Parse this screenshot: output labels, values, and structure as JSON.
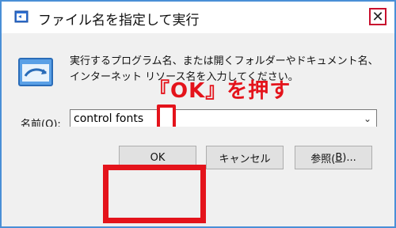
{
  "window": {
    "title": "ファイル名を指定して実行",
    "close_glyph": "✕"
  },
  "description": "実行するプログラム名、または開くフォルダーやドキュメント名、インターネット リソース名を入力してください。",
  "annotation": {
    "text": "『OK』を押す",
    "color": "#e4131b"
  },
  "name_field": {
    "label_prefix": "名前(",
    "label_key": "O",
    "label_suffix": "):",
    "value": "control fonts",
    "dropdown_glyph": "⌄"
  },
  "buttons": {
    "ok": "OK",
    "cancel": "キャンセル",
    "browse_prefix": "参照(",
    "browse_key": "B",
    "browse_suffix": ")..."
  },
  "icons": {
    "title": "run-dialog-icon",
    "run": "run-program-icon",
    "close": "close-icon",
    "dropdown": "chevron-down-icon",
    "arrow": "down-arrow-icon"
  }
}
